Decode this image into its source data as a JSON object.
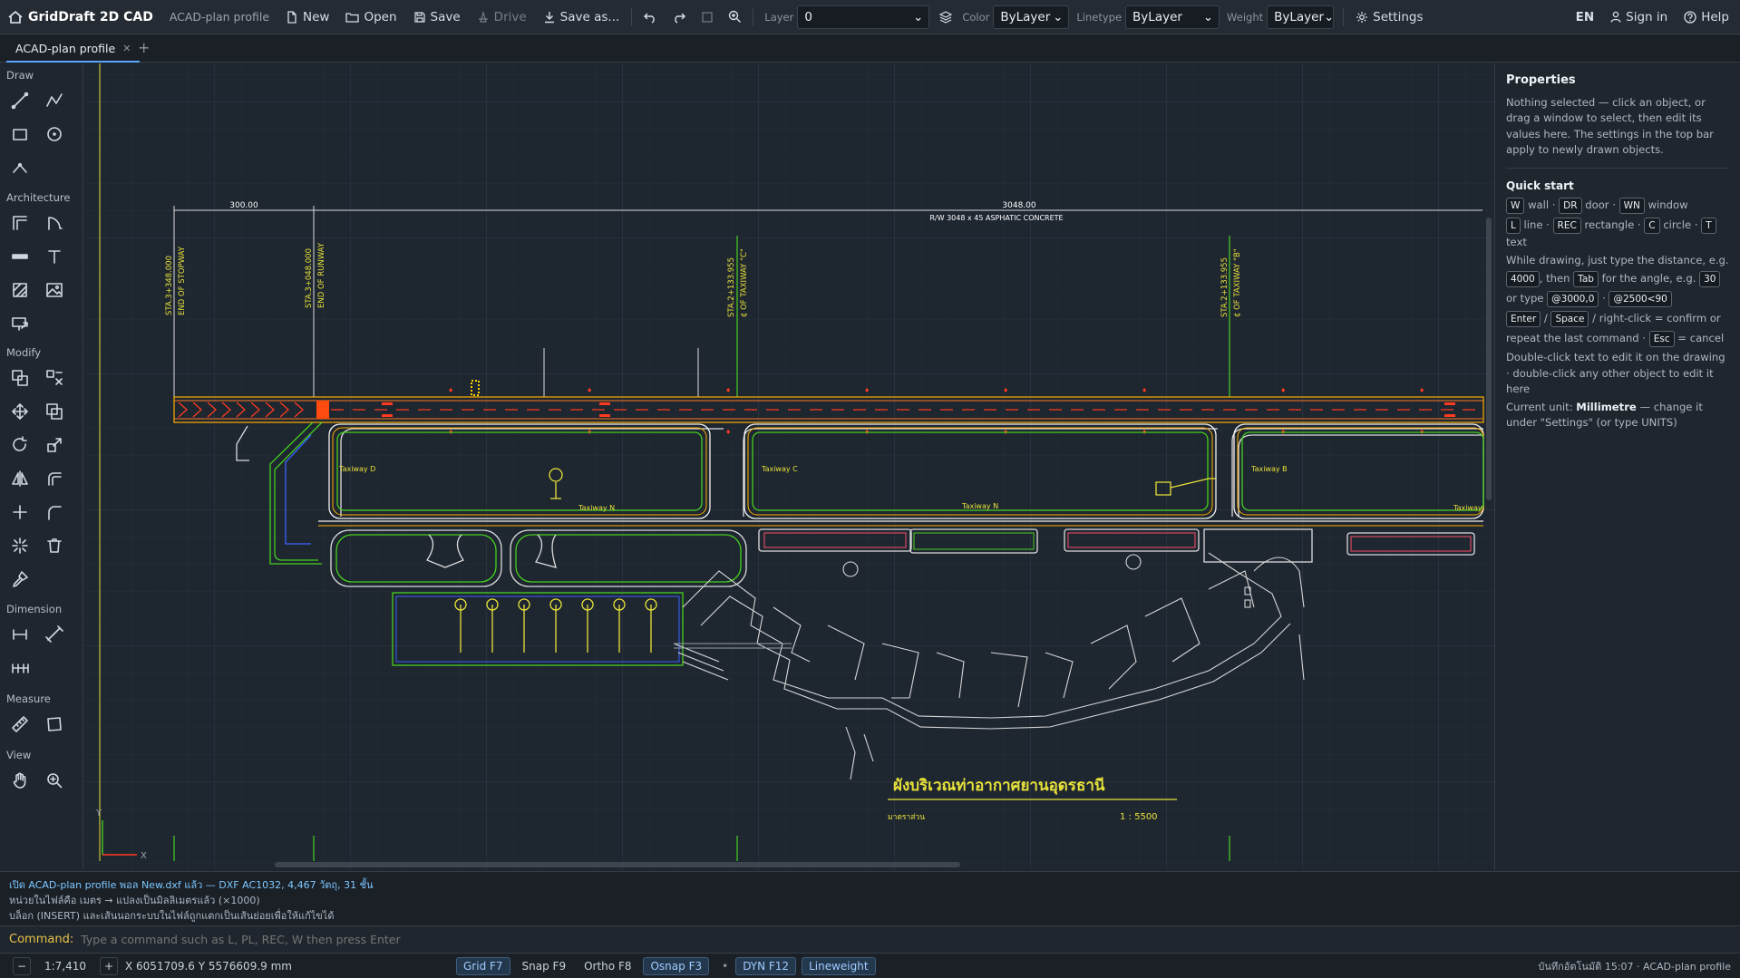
{
  "app": {
    "title": "GridDraft 2D CAD",
    "doc_name": "ACAD-plan profile"
  },
  "toolbar": {
    "new": "New",
    "open": "Open",
    "save": "Save",
    "drive": "Drive",
    "save_as": "Save as...",
    "layer_label": "Layer",
    "layer_value": "0",
    "color_label": "Color",
    "color_value": "ByLayer",
    "linetype_label": "Linetype",
    "linetype_value": "ByLayer",
    "weight_label": "Weight",
    "weight_value": "ByLayer",
    "settings": "Settings",
    "lang": "EN",
    "sign_in": "Sign in",
    "help": "Help"
  },
  "tabs": [
    {
      "label": "ACAD-plan profile"
    }
  ],
  "toolbox": {
    "groups": [
      "Draw",
      "Architecture",
      "Modify",
      "Dimension",
      "Measure",
      "View"
    ]
  },
  "drawing": {
    "dim_left": "300.00",
    "dim_main": "3048.00",
    "runway_label": "R/W 3048 x 45 ASPHATIC CONCRETE",
    "sta1_a": "STA.3+348.000",
    "sta1_b": "END OF STOPWAY",
    "sta2_a": "STA.3+048.000",
    "sta2_b": "END OF RUNWAY",
    "sta3_a": "STA.2+133.955",
    "sta3_b": "¢ OF TAXIWAY \"C\"",
    "sta4_a": "STA.2+133.955",
    "sta4_b": "¢ OF TAXIWAY \"B\"",
    "twy_d": "Taxiway D",
    "twy_c": "Taxiway C",
    "twy_b": "Taxiway B",
    "twy_n1": "Taxiway N",
    "twy_n2": "Taxiway N",
    "twy_edge": "Taxiway",
    "title_th": "ผังบริเวณท่าอากาศยานอุดรธานี",
    "scale_label": "มาตราส่วน",
    "scale_value": "1 : 5500",
    "axis_x": "X",
    "axis_y": "Y"
  },
  "properties": {
    "title": "Properties",
    "intro": "Nothing selected — click an object, or drag a window to select, then edit its values here. The settings in the top bar apply to newly drawn objects.",
    "quick_title": "Quick start",
    "k_w": "W",
    "t_wall": "wall ·",
    "k_dr": "DR",
    "t_door": "door ·",
    "k_wn": "WN",
    "t_window": "window",
    "k_l": "L",
    "t_line": "line ·",
    "k_rec": "REC",
    "t_rect": "rectangle ·",
    "k_c": "C",
    "t_circle": "circle ·",
    "k_t": "T",
    "t_text": "text",
    "dist_text": "While drawing, just type the distance, e.g.",
    "k_4000": "4000",
    "t_then": ", then",
    "k_tab": "Tab",
    "t_angle": "for the angle, e.g.",
    "k_30": "30",
    "t_ortype": "or type",
    "k_rel": "@3000,0",
    "t_dot": "·",
    "k_pol": "@2500<90",
    "k_enter": "Enter",
    "t_slash": "/",
    "k_space": "Space",
    "t_confirm": "/ right-click = confirm or",
    "t_repeat": "repeat the last command ·",
    "k_esc": "Esc",
    "t_cancel": "= cancel",
    "dbl_text": "Double-click text to edit it on the drawing · double-click any other object to edit it here",
    "unit_pre": "Current unit:",
    "unit_value": "Millimetre",
    "unit_post": "— change it under \"Settings\" (or type UNITS)"
  },
  "log": {
    "line1": "เปิด ACAD-plan profile พอล New.dxf แล้ว — DXF AC1032, 4,467 วัตถุ, 31 ชั้น",
    "line2": "หน่วยในไฟล์คือ เมตร → แปลงเป็นมิลลิเมตรแล้ว (×1000)",
    "line3": "บล็อก (INSERT) และเส้นนอกระบบในไฟล์ถูกแตกเป็นเส้นย่อยเพื่อให้แก้ไขได้"
  },
  "command": {
    "label": "Command:",
    "placeholder": "Type a command such as L, PL, REC, W then press Enter"
  },
  "status": {
    "minus": "−",
    "zoom": "1:7,410",
    "plus": "+",
    "coords": "X 6051709.6 Y 5576609.9 mm",
    "grid": "Grid F7",
    "snap": "Snap F9",
    "ortho": "Ortho F8",
    "osnap": "Osnap F3",
    "dot": "•",
    "dyn": "DYN F12",
    "lineweight": "Lineweight",
    "autosave": "บันทึกอัตโนมัติ 15:07 · ACAD-plan profile"
  },
  "colors": {
    "accent": "#58a6ff",
    "yellow": "#e8e23a",
    "green": "#46d01f",
    "red": "#ff3b1f",
    "orange": "#ff7b22"
  }
}
